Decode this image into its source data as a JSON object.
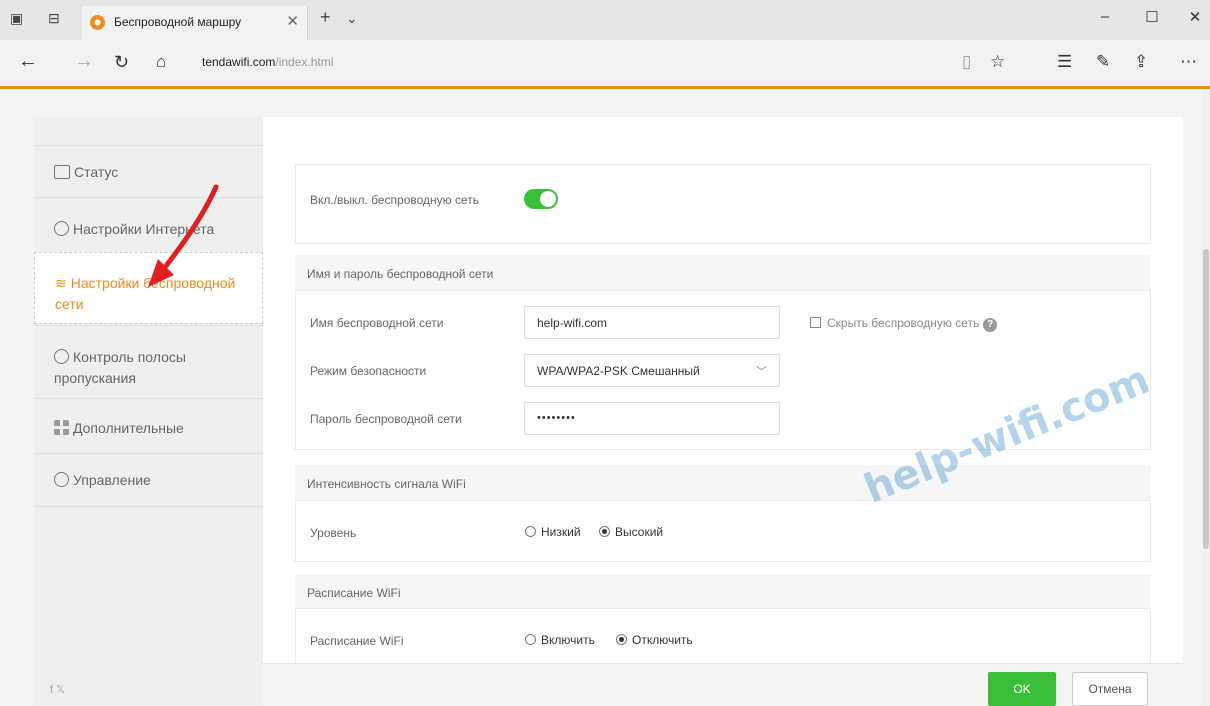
{
  "browser": {
    "tab_title": "Беспроводной маршру",
    "new_tab": "+",
    "tab_menu": "⌄",
    "url_host": "tendawifi.com",
    "url_path": "/index.html"
  },
  "sidebar": {
    "items": [
      {
        "label": "Статус",
        "icon": "status-icon"
      },
      {
        "label": "Настройки Интернета",
        "icon": "globe-icon"
      },
      {
        "label": "Настройки беспроводной сети",
        "icon": "wifi-icon"
      },
      {
        "label": "Контроль полосы пропускания",
        "icon": "gauge-icon"
      },
      {
        "label": "Дополнительные",
        "icon": "grid-icon"
      },
      {
        "label": "Управление",
        "icon": "gear-icon"
      }
    ],
    "social": "f  𝕏"
  },
  "wireless": {
    "toggle_label": "Вкл./выкл. беспроводную сеть",
    "toggle_on": true
  },
  "ssid_section": {
    "title": "Имя и пароль беспроводной сети",
    "name_label": "Имя беспроводной сети",
    "name_value": "help-wifi.com",
    "hide_label": "Скрыть беспроводную сеть",
    "security_label": "Режим безопасности",
    "security_value": "WPA/WPA2-PSK Смешанный",
    "password_label": "Пароль беспроводной сети",
    "password_value": "••••••••"
  },
  "signal_section": {
    "title": "Интенсивность сигнала WiFi",
    "level_label": "Уровень",
    "options": [
      "Низкий",
      "Высокий"
    ],
    "selected": "Высокий"
  },
  "schedule_section": {
    "title": "Расписание WiFi",
    "label": "Расписание WiFi",
    "options": [
      "Включить",
      "Отключить"
    ],
    "selected": "Отключить"
  },
  "buttons": {
    "ok": "OK",
    "cancel": "Отмена"
  },
  "watermark": "help-wifi.com",
  "colors": {
    "accent": "#f08a1d",
    "green": "#3bbf3b"
  }
}
